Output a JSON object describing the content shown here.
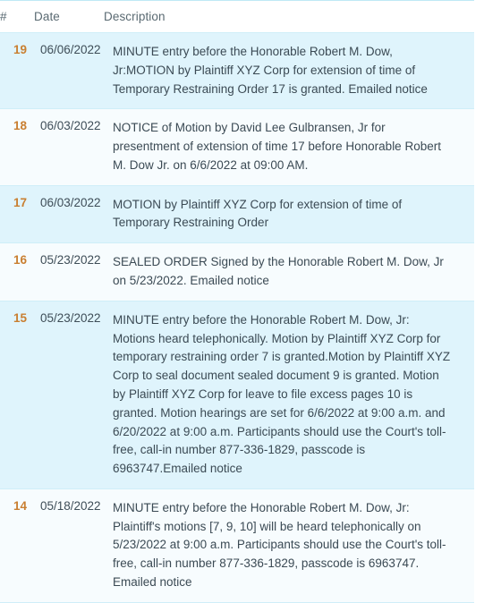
{
  "table": {
    "columns": [
      {
        "key": "number",
        "label": "#"
      },
      {
        "key": "date",
        "label": "Date"
      },
      {
        "key": "description",
        "label": "Description"
      }
    ],
    "accent_number_color": "#c97f31",
    "row_color_primary": "#dff4fc",
    "row_color_secondary": "#f7fcfe",
    "border_color": "#cfeef8",
    "text_color": "#3b4a54",
    "header_text_color": "#5a6a72",
    "rows": [
      {
        "number": "19",
        "date": "06/06/2022",
        "description": "MINUTE entry before the Honorable Robert M. Dow, Jr:MOTION by Plaintiff XYZ Corp for extension of time of Temporary Restraining Order 17 is granted. Emailed notice"
      },
      {
        "number": "18",
        "date": "06/03/2022",
        "description": "NOTICE of Motion by David Lee Gulbransen, Jr for presentment of extension of time 17 before Honorable Robert M. Dow Jr. on 6/6/2022 at 09:00 AM."
      },
      {
        "number": "17",
        "date": "06/03/2022",
        "description": "MOTION by Plaintiff XYZ Corp for extension of time of Temporary Restraining Order"
      },
      {
        "number": "16",
        "date": "05/23/2022",
        "description": "SEALED ORDER Signed by the Honorable Robert M. Dow, Jr on 5/23/2022. Emailed notice"
      },
      {
        "number": "15",
        "date": "05/23/2022",
        "description": "MINUTE entry before the Honorable Robert M. Dow, Jr: Motions heard telephonically. Motion by Plaintiff XYZ Corp for temporary restraining order 7 is granted.Motion by Plaintiff XYZ Corp to seal document sealed document 9 is granted. Motion by Plaintiff XYZ Corp for leave to file excess pages 10 is granted. Motion hearings are set for 6/6/2022 at 9:00 a.m. and 6/20/2022 at 9:00 a.m. Participants should use the Court's toll-free, call-in number 877-336-1829, passcode is 6963747.Emailed notice"
      },
      {
        "number": "14",
        "date": "05/18/2022",
        "description": "MINUTE entry before the Honorable Robert M. Dow, Jr: Plaintiff's motions [7, 9, 10] will be heard telephonically on 5/23/2022 at 9:00 a.m. Participants should use the Court's toll-free, call-in number 877-336-1829, passcode is 6963747. Emailed notice"
      }
    ]
  }
}
